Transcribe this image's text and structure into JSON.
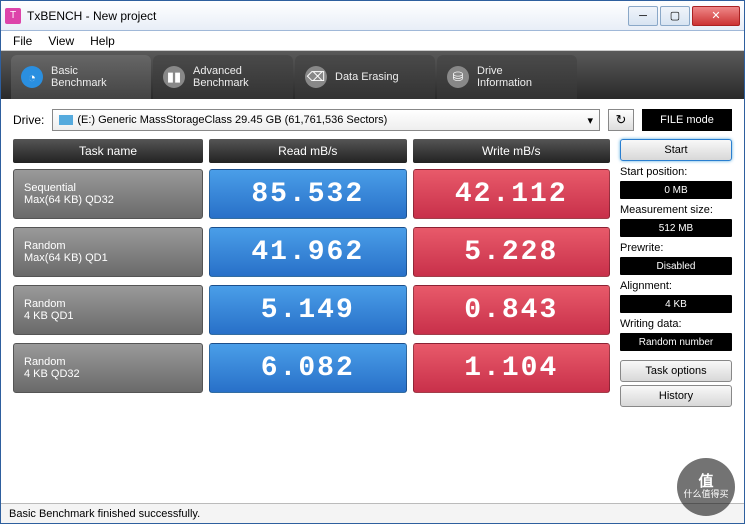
{
  "window": {
    "title": "TxBENCH - New project"
  },
  "menu": {
    "file": "File",
    "view": "View",
    "help": "Help"
  },
  "tabs": {
    "basic": "Basic\nBenchmark",
    "advanced": "Advanced\nBenchmark",
    "erase": "Data Erasing",
    "drive": "Drive\nInformation"
  },
  "drive": {
    "label": "Drive:",
    "selected": "(E:) Generic MassStorageClass   29.45 GB (61,761,536 Sectors)",
    "filemode": "FILE mode"
  },
  "headers": {
    "task": "Task name",
    "read": "Read mB/s",
    "write": "Write mB/s"
  },
  "rows": [
    {
      "name1": "Sequential",
      "name2": "Max(64 KB) QD32",
      "read": "85.532",
      "write": "42.112"
    },
    {
      "name1": "Random",
      "name2": "Max(64 KB) QD1",
      "read": "41.962",
      "write": "5.228"
    },
    {
      "name1": "Random",
      "name2": "4 KB QD1",
      "read": "5.149",
      "write": "0.843"
    },
    {
      "name1": "Random",
      "name2": "4 KB QD32",
      "read": "6.082",
      "write": "1.104"
    }
  ],
  "sidebar": {
    "start": "Start",
    "startpos_l": "Start position:",
    "startpos_v": "0 MB",
    "msize_l": "Measurement size:",
    "msize_v": "512 MB",
    "prewrite_l": "Prewrite:",
    "prewrite_v": "Disabled",
    "align_l": "Alignment:",
    "align_v": "4 KB",
    "wdata_l": "Writing data:",
    "wdata_v": "Random number",
    "taskopt": "Task options",
    "history": "History"
  },
  "status": "Basic Benchmark finished successfully.",
  "watermark": {
    "big": "值",
    "small": "什么值得买"
  }
}
